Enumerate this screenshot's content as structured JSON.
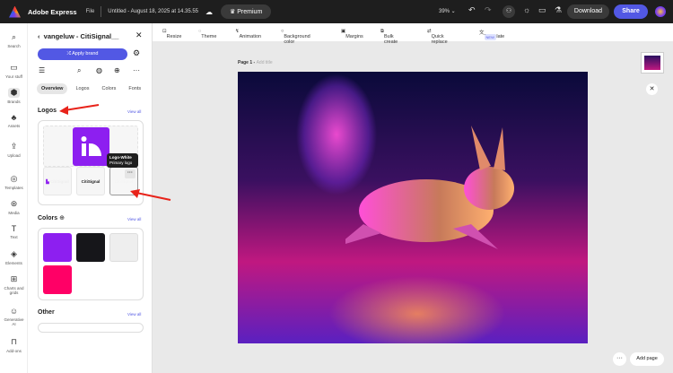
{
  "topbar": {
    "app": "Adobe Express",
    "file": "File",
    "doc_title": "Untitled - August 18, 2025 at 14.35.55",
    "premium": "Premium",
    "zoom": "39%",
    "download": "Download",
    "share": "Share"
  },
  "rail": [
    {
      "label": "Search",
      "icon": "search-icon"
    },
    {
      "label": "Your stuff",
      "icon": "folder-icon"
    },
    {
      "label": "Brands",
      "icon": "brand-icon"
    },
    {
      "label": "Assets",
      "icon": "assets-icon"
    },
    {
      "label": "Upload",
      "icon": "upload-icon"
    },
    {
      "label": "Templates",
      "icon": "templates-icon"
    },
    {
      "label": "Media",
      "icon": "media-icon"
    },
    {
      "label": "Text",
      "icon": "text-icon"
    },
    {
      "label": "Elements",
      "icon": "elements-icon"
    },
    {
      "label": "Charts and grids",
      "icon": "chart-icon"
    },
    {
      "label": "Generative AI",
      "icon": "ai-icon"
    },
    {
      "label": "Add-ons",
      "icon": "addons-icon"
    }
  ],
  "panel": {
    "title": "vangeluw - CitiSignal__",
    "apply_brand": "Apply brand",
    "tabs": [
      "Overview",
      "Logos",
      "Colors",
      "Fonts"
    ],
    "active_tab": "Overview",
    "logos": {
      "heading": "Logos",
      "view_all": "View all",
      "tiles": [
        "CitiSignal",
        "CitiSignal",
        "CitiSignal"
      ],
      "tooltip_title": "Logo-White",
      "tooltip_sub": "Primary logo"
    },
    "colors": {
      "heading": "Colors",
      "view_all": "View all",
      "swatches": [
        "#8d1ff0",
        "#16161a",
        "#eeeeee",
        "#ff0066"
      ]
    },
    "other": {
      "heading": "Other",
      "view_all": "View all"
    }
  },
  "toolbar": [
    "Resize",
    "Theme",
    "Animation",
    "Background color",
    "Margins",
    "Bulk create",
    "Quick replace",
    "Translate"
  ],
  "toolbar_badge": "NEW",
  "canvas": {
    "page_label": "Page 1 - ",
    "title_placeholder": "Add title",
    "add_page": "Add page"
  },
  "colors": {
    "accent": "#5258e4",
    "annotation": "#e8231a"
  }
}
